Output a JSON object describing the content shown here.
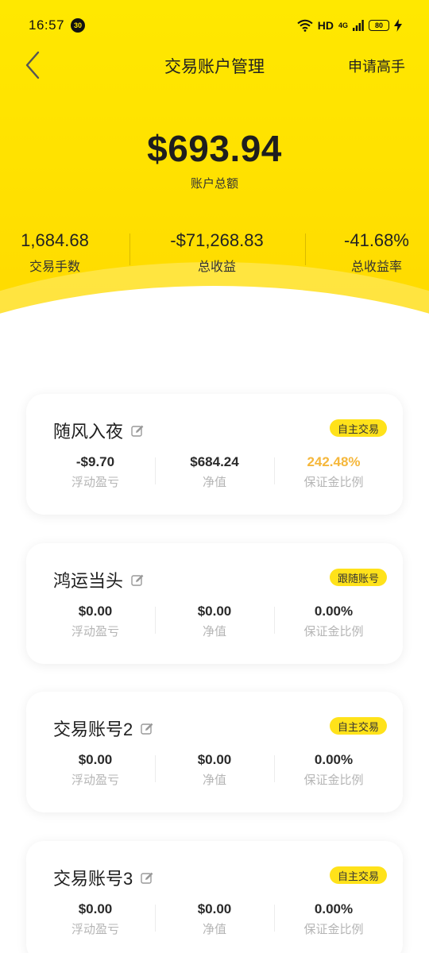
{
  "status_bar": {
    "time": "16:57",
    "notification_count": "30",
    "network": "HD",
    "signal": "4G",
    "battery": "80"
  },
  "nav": {
    "title": "交易账户管理",
    "action": "申请高手"
  },
  "summary": {
    "balance": "$693.94",
    "balance_label": "账户总额",
    "stats": [
      {
        "value": "1,684.68",
        "label": "交易手数"
      },
      {
        "value": "-$71,268.83",
        "label": "总收益"
      },
      {
        "value": "-41.68%",
        "label": "总收益率"
      }
    ]
  },
  "accounts": [
    {
      "name": "随风入夜",
      "tag": "自主交易",
      "metrics": [
        {
          "value": "-$9.70",
          "label": "浮动盈亏"
        },
        {
          "value": "$684.24",
          "label": "净值"
        },
        {
          "value": "242.48%",
          "label": "保证金比例"
        }
      ]
    },
    {
      "name": "鸿运当头",
      "tag": "跟随账号",
      "metrics": [
        {
          "value": "$0.00",
          "label": "浮动盈亏"
        },
        {
          "value": "$0.00",
          "label": "净值"
        },
        {
          "value": "0.00%",
          "label": "保证金比例"
        }
      ]
    },
    {
      "name": "交易账号2",
      "tag": "自主交易",
      "metrics": [
        {
          "value": "$0.00",
          "label": "浮动盈亏"
        },
        {
          "value": "$0.00",
          "label": "净值"
        },
        {
          "value": "0.00%",
          "label": "保证金比例"
        }
      ]
    },
    {
      "name": "交易账号3",
      "tag": "自主交易",
      "metrics": [
        {
          "value": "$0.00",
          "label": "浮动盈亏"
        },
        {
          "value": "$0.00",
          "label": "净值"
        },
        {
          "value": "0.00%",
          "label": "保证金比例"
        }
      ]
    }
  ],
  "colors": {
    "hero_yellow": "#ffe400",
    "tag_yellow": "#ffe21a",
    "highlight_orange": "#f5b73b"
  }
}
